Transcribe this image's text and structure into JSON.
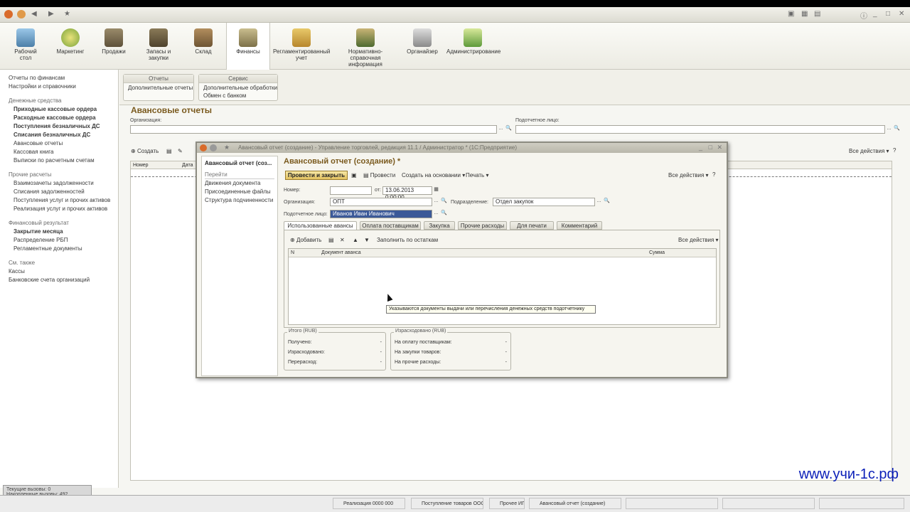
{
  "sections": [
    {
      "label": "Рабочий стол"
    },
    {
      "label": "Маркетинг"
    },
    {
      "label": "Продажи"
    },
    {
      "label": "Запасы и закупки"
    },
    {
      "label": "Склад"
    },
    {
      "label": "Финансы"
    },
    {
      "label": "Регламентированный учет"
    },
    {
      "label": "Нормативно-справочная информация"
    },
    {
      "label": "Органайзер"
    },
    {
      "label": "Администрирование"
    }
  ],
  "leftnav": {
    "items": [
      "Отчеты по финансам",
      "Настройки и справочники",
      "Денежные средства",
      "Приходные кассовые ордера",
      "Расходные кассовые ордера",
      "Поступления безналичных ДС",
      "Списания безналичных ДС",
      "Авансовые отчеты",
      "Кассовая книга",
      "Выписки по расчетным счетам",
      "Прочие расчеты",
      "Взаимозачеты задолженности",
      "Списания задолженностей",
      "Поступления услуг и прочих активов",
      "Реализация услуг и прочих активов",
      "Финансовый результат",
      "Закрытие месяца",
      "Распределение РБП",
      "Регламентные документы",
      "См. также",
      "Кассы",
      "Банковские счета организаций"
    ]
  },
  "cmdpanel": {
    "group1_title": "Отчеты",
    "group1_item": "Дополнительные отчеты",
    "group2_title": "Сервис",
    "group2_item1": "Дополнительные обработки",
    "group2_item2": "Обмен с банком"
  },
  "mainform": {
    "title": "Авансовые отчеты",
    "org_label": "Организация:",
    "person_label": "Подотчетное лицо:",
    "create_button": "Создать",
    "all_actions": "Все действия",
    "col_number": "Номер",
    "col_date": "Дата"
  },
  "dialog": {
    "window_title": "Авансовый отчет (создание) - Управление торговлей, редакция 11.1 / Администратор * (1С:Предприятие)",
    "nav_current": "Авансовый отчет (соз...",
    "nav_goto": "Перейти",
    "nav_items": [
      "Движения документа",
      "Присоединенные файлы",
      "Структура подчиненности"
    ],
    "heading": "Авансовый отчет (создание) *",
    "post_close": "Провести и закрыть",
    "post": "Провести",
    "create_based": "Создать на основании",
    "print": "Печать",
    "all_actions": "Все действия",
    "number_label": "Номер:",
    "number_value": "",
    "date_prefix": "от:",
    "date_value": "13.06.2013  0:00:00",
    "org_label": "Организация:",
    "org_value": "ОПТ",
    "dept_label": "Подразделение:",
    "dept_value": "Отдел закупок",
    "person_label": "Подотчетное лицо:",
    "person_value": "Иванов Иван Иванович",
    "tabs": [
      "Использованные авансы",
      "Оплата поставщикам",
      "Закупка",
      "Прочие расходы",
      "Для печати",
      "Комментарий"
    ],
    "add_button": "Добавить",
    "fill_remaining": "Заполнить по остаткам",
    "tab_all_actions": "Все действия",
    "col_n": "N",
    "col_doc": "Документ аванса",
    "col_sum": "Сумма",
    "tooltip": "Указываются документы выдачи или перечисления денежных средств подотчетнику",
    "totals_title": "Итого (RUB)",
    "received": "Получено:",
    "spent": "Израсходовано:",
    "overspent": "Перерасход:",
    "spent_title": "Израсходовано (RUB)",
    "to_suppliers": "На оплату поставщикам:",
    "on_purchases": "На закупки товаров:",
    "other_expenses": "На прочие расходы:",
    "dash": "-"
  },
  "taskbar": {
    "status_line1": "Текущие вызовы: 0",
    "status_line2": "Накопленные вызовы: 492",
    "items": [
      "Реализация 0000 000",
      "Поступление товаров ООО",
      "Прочее ИП",
      "Авансовый отчет (создание)",
      "",
      "",
      ""
    ]
  },
  "watermark": "www.учи-1с.рф",
  "colors": {
    "accent": "#7a5a1e",
    "primary_button": "#e3c25f",
    "watermark": "#0b1fb8"
  }
}
